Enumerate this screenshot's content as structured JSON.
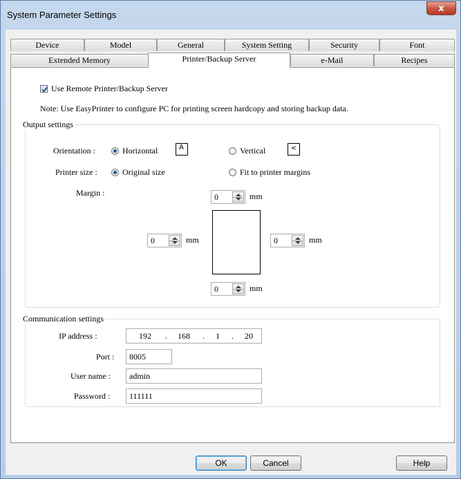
{
  "window": {
    "title": "System Parameter Settings",
    "close_glyph": "x"
  },
  "tabs_row1": [
    {
      "label": "Device"
    },
    {
      "label": "Model"
    },
    {
      "label": "General"
    },
    {
      "label": "System Setting"
    },
    {
      "label": "Security"
    },
    {
      "label": "Font"
    }
  ],
  "tabs_row2": [
    {
      "label": "Extended Memory"
    },
    {
      "label": "Printer/Backup Server",
      "active": true
    },
    {
      "label": "e-Mail"
    },
    {
      "label": "Recipes"
    }
  ],
  "use_remote": {
    "label": "Use Remote Printer/Backup Server",
    "checked": true
  },
  "note": "Note: Use EasyPrinter to configure PC for printing screen hardcopy and storing backup data.",
  "output": {
    "legend": "Output settings",
    "orientation": {
      "label": "Orientation :",
      "options": [
        "Horizontal",
        "Vertical"
      ],
      "selected": "Horizontal",
      "h_icon_glyph": "A",
      "v_icon_glyph": "<"
    },
    "printer_size": {
      "label": "Printer size :",
      "options": [
        "Original size",
        "Fit to printer margins"
      ],
      "selected": "Original size"
    },
    "margin": {
      "label": "Margin :",
      "unit": "mm",
      "top": "0",
      "left": "0",
      "right": "0",
      "bottom": "0"
    }
  },
  "communication": {
    "legend": "Communication settings",
    "ip": {
      "label": "IP address :",
      "octets": [
        "192",
        "168",
        "1",
        "20"
      ],
      "separator": "."
    },
    "port": {
      "label": "Port :",
      "value": "8005"
    },
    "username": {
      "label": "User name :",
      "value": "admin"
    },
    "password": {
      "label": "Password :",
      "value": "111111"
    }
  },
  "buttons": {
    "ok": "OK",
    "cancel": "Cancel",
    "help": "Help"
  },
  "colors": {
    "title_bar": "#b9cee7",
    "close": "#c75744",
    "radio_dot": "#1f4fa5"
  },
  "icons": {
    "close": "close-icon",
    "check": "checkmark-icon",
    "spin": "spin-arrows-icon"
  }
}
